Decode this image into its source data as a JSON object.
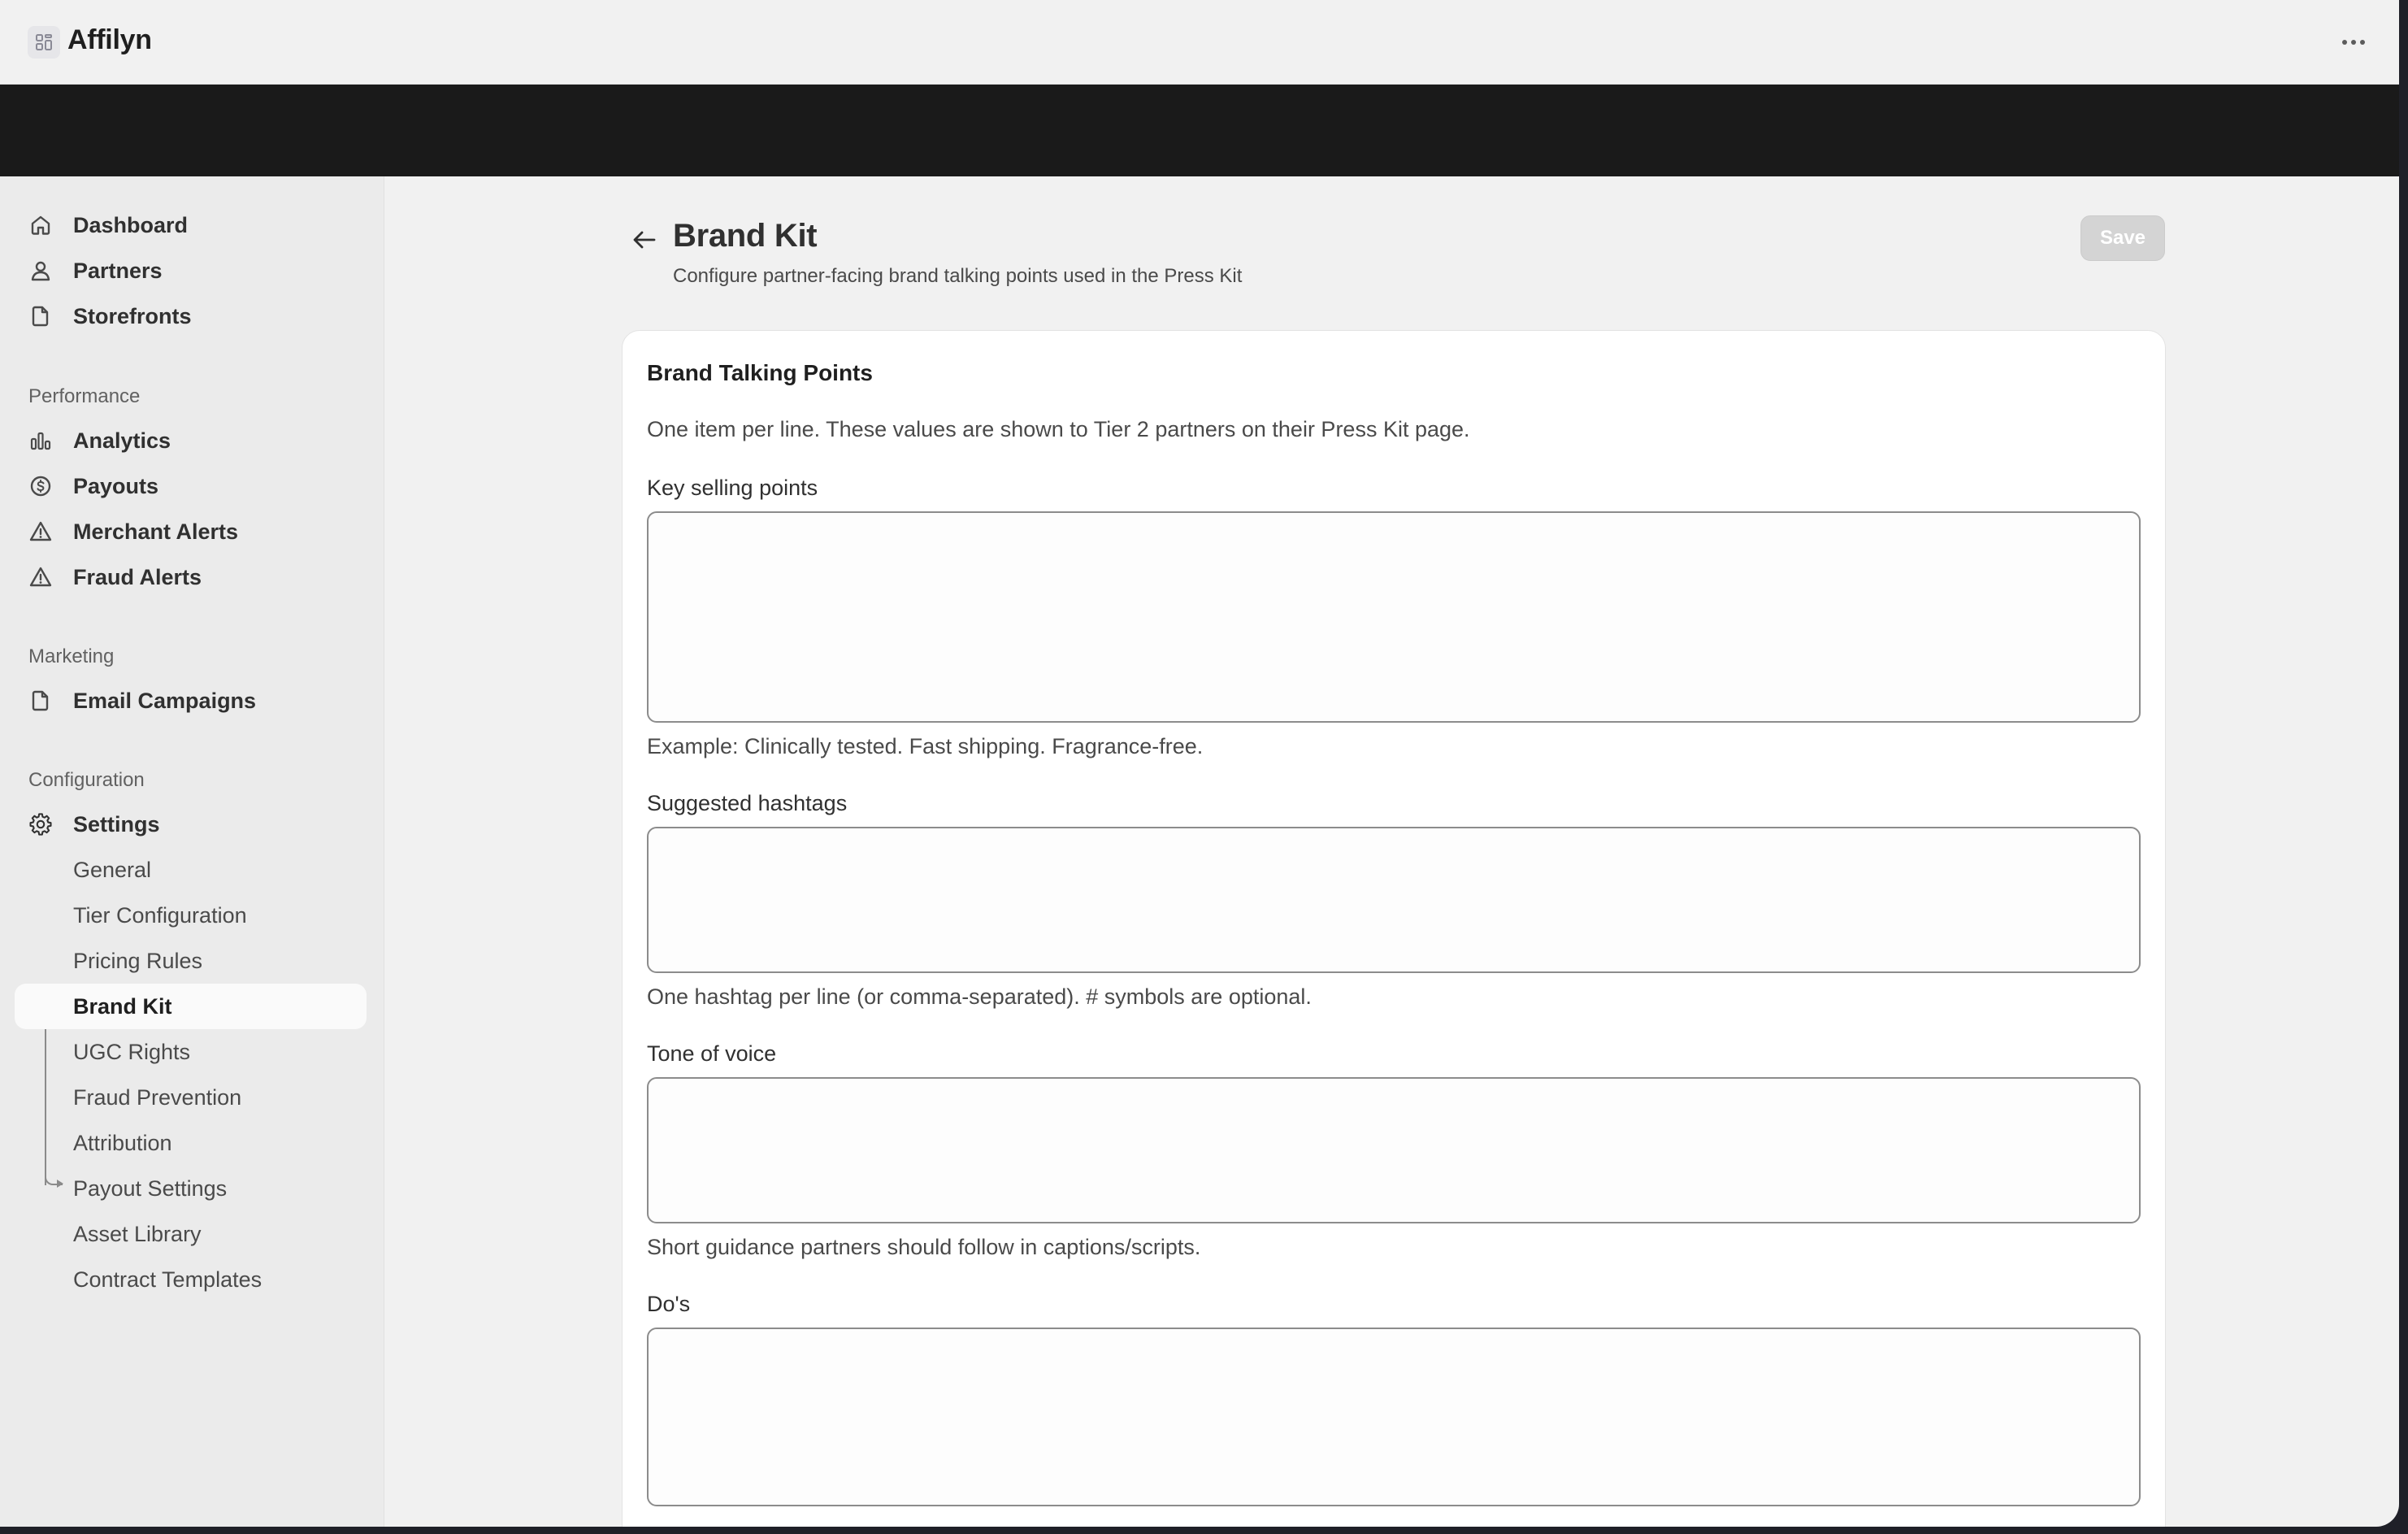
{
  "app": {
    "title": "Affilyn",
    "icon": "app-grid-icon",
    "menu_icon": "more-horizontal-icon"
  },
  "sidebar": {
    "primary": [
      {
        "label": "Dashboard",
        "icon": "home-icon"
      },
      {
        "label": "Partners",
        "icon": "person-icon"
      },
      {
        "label": "Storefronts",
        "icon": "document-icon"
      }
    ],
    "sections": [
      {
        "heading": "Performance",
        "items": [
          {
            "label": "Analytics",
            "icon": "bar-chart-icon"
          },
          {
            "label": "Payouts",
            "icon": "dollar-circle-icon"
          },
          {
            "label": "Merchant Alerts",
            "icon": "warning-triangle-icon"
          },
          {
            "label": "Fraud Alerts",
            "icon": "warning-triangle-icon"
          }
        ]
      },
      {
        "heading": "Marketing",
        "items": [
          {
            "label": "Email Campaigns",
            "icon": "document-icon"
          }
        ]
      },
      {
        "heading": "Configuration",
        "items": [
          {
            "label": "Settings",
            "icon": "gear-icon"
          }
        ]
      }
    ],
    "settings_sub": [
      {
        "label": "General",
        "active": false
      },
      {
        "label": "Tier Configuration",
        "active": false
      },
      {
        "label": "Pricing Rules",
        "active": false
      },
      {
        "label": "Brand Kit",
        "active": true
      },
      {
        "label": "UGC Rights",
        "active": false
      },
      {
        "label": "Fraud Prevention",
        "active": false
      },
      {
        "label": "Attribution",
        "active": false
      },
      {
        "label": "Payout Settings",
        "active": false
      },
      {
        "label": "Asset Library",
        "active": false
      },
      {
        "label": "Contract Templates",
        "active": false
      }
    ]
  },
  "page": {
    "title": "Brand Kit",
    "subtitle": "Configure partner-facing brand talking points used in the Press Kit",
    "save_label": "Save",
    "back_icon": "arrow-left-icon"
  },
  "card": {
    "title": "Brand Talking Points",
    "description": "One item per line. These values are shown to Tier 2 partners on their Press Kit page.",
    "fields": [
      {
        "label": "Key selling points",
        "value": "",
        "help": "Example: Clinically tested. Fast shipping. Fragrance-free."
      },
      {
        "label": "Suggested hashtags",
        "value": "",
        "help": "One hashtag per line (or comma-separated). # symbols are optional."
      },
      {
        "label": "Tone of voice",
        "value": "",
        "help": "Short guidance partners should follow in captions/scripts."
      },
      {
        "label": "Do's",
        "value": "",
        "help": ""
      }
    ]
  },
  "colors": {
    "sidebar_bg": "#ebebeb",
    "app_bg": "#f1f1f1",
    "band": "#1a1a1a",
    "save_disabled": "#d4d4d4",
    "text": "#303030"
  }
}
